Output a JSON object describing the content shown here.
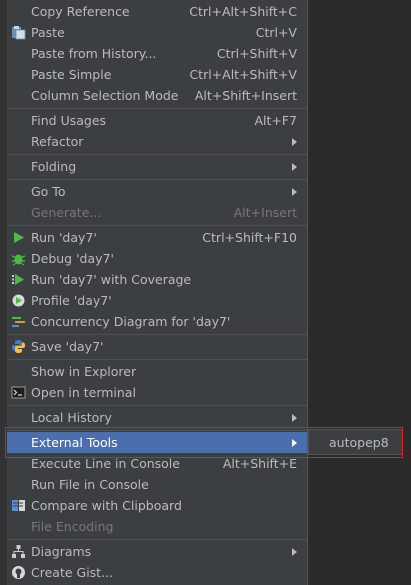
{
  "menu": {
    "items": [
      {
        "label": "Copy Reference",
        "shortcut": "Ctrl+Alt+Shift+C"
      },
      {
        "label": "Paste",
        "shortcut": "Ctrl+V"
      },
      {
        "label": "Paste from History...",
        "shortcut": "Ctrl+Shift+V"
      },
      {
        "label": "Paste Simple",
        "shortcut": "Ctrl+Alt+Shift+V"
      },
      {
        "label": "Column Selection Mode",
        "shortcut": "Alt+Shift+Insert"
      },
      {
        "label": "Find Usages",
        "shortcut": "Alt+F7"
      },
      {
        "label": "Refactor",
        "shortcut": ""
      },
      {
        "label": "Folding",
        "shortcut": ""
      },
      {
        "label": "Go To",
        "shortcut": ""
      },
      {
        "label": "Generate...",
        "shortcut": "Alt+Insert"
      },
      {
        "label": "Run 'day7'",
        "shortcut": "Ctrl+Shift+F10"
      },
      {
        "label": "Debug 'day7'",
        "shortcut": ""
      },
      {
        "label": "Run 'day7' with Coverage",
        "shortcut": ""
      },
      {
        "label": "Profile 'day7'",
        "shortcut": ""
      },
      {
        "label": "Concurrency Diagram for 'day7'",
        "shortcut": ""
      },
      {
        "label": "Save 'day7'",
        "shortcut": ""
      },
      {
        "label": "Show in Explorer",
        "shortcut": ""
      },
      {
        "label": "Open in terminal",
        "shortcut": ""
      },
      {
        "label": "Local History",
        "shortcut": ""
      },
      {
        "label": "External Tools",
        "shortcut": ""
      },
      {
        "label": "Execute Line in Console",
        "shortcut": "Alt+Shift+E"
      },
      {
        "label": "Run File in Console",
        "shortcut": ""
      },
      {
        "label": "Compare with Clipboard",
        "shortcut": ""
      },
      {
        "label": "File Encoding",
        "shortcut": ""
      },
      {
        "label": "Diagrams",
        "shortcut": ""
      },
      {
        "label": "Create Gist...",
        "shortcut": ""
      }
    ]
  },
  "submenu": {
    "items": [
      {
        "label": "autopep8"
      }
    ]
  },
  "colors": {
    "menu_bg": "#3c3f41",
    "selected_bg": "#4b6eaf",
    "text": "#bbbbbb",
    "disabled_text": "#777777",
    "highlight_border": "#e02020"
  }
}
